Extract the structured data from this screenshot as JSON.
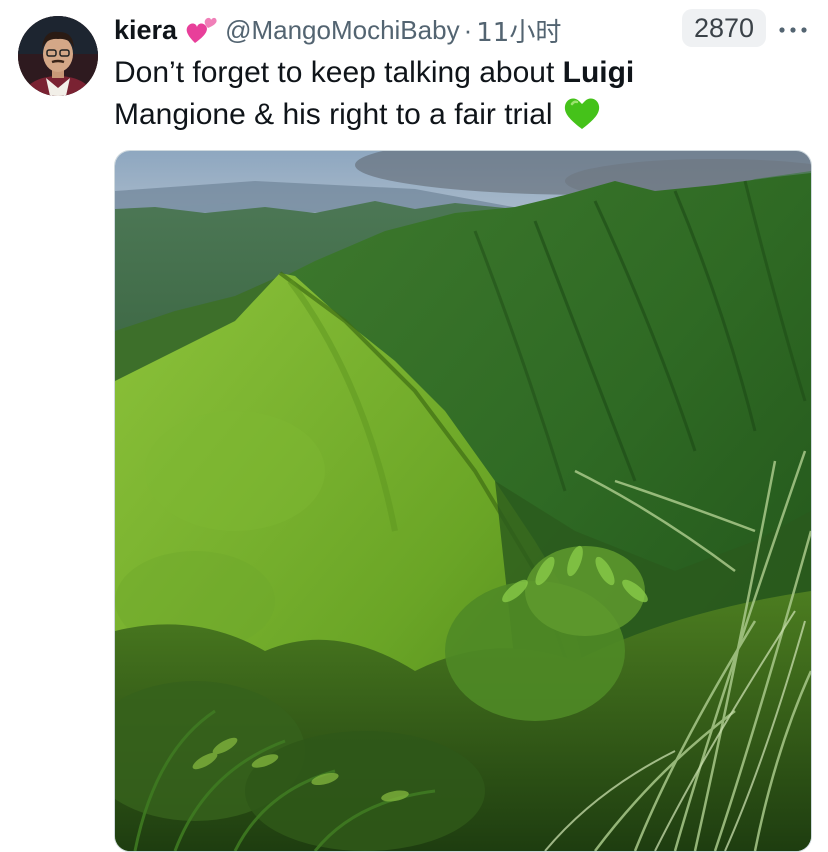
{
  "tweet": {
    "author_name": "kiera",
    "name_emoji": "two-hearts-icon",
    "handle": "@MangoMochiBaby",
    "separator": "·",
    "time": "11小时",
    "views": "2870",
    "text_before": "Don’t forget to keep talking about ",
    "text_bold": "Luigi",
    "text_line2": "Mangione & his right to a fair trial",
    "end_emoji": "green-heart-icon"
  },
  "colors": {
    "text": "#0f1419",
    "secondary": "#536471",
    "pink_heart": "#e83f9a",
    "green_heart": "#45c21a"
  }
}
